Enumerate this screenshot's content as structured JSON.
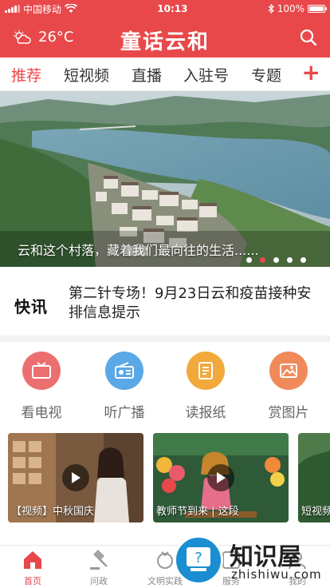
{
  "status_bar": {
    "carrier": "中国移动",
    "time": "10:13",
    "battery": "100%"
  },
  "header": {
    "temperature": "26°C",
    "app_title": "童话云和"
  },
  "tabs": [
    {
      "label": "推荐",
      "active": true
    },
    {
      "label": "短视频",
      "active": false
    },
    {
      "label": "直播",
      "active": false
    },
    {
      "label": "入驻号",
      "active": false
    },
    {
      "label": "专题",
      "active": false
    }
  ],
  "banner": {
    "caption": "云和这个村落，藏着我们最向往的生活......",
    "slide_count": 5,
    "active_slide": 2
  },
  "news_flash": {
    "logo_text": "快讯",
    "headline": "第二针专场！9月23日云和疫苗接种安排信息提示"
  },
  "services": [
    {
      "label": "看电视",
      "icon": "tv-icon",
      "color": "#ec6f6f"
    },
    {
      "label": "听广播",
      "icon": "radio-icon",
      "color": "#5aa8e6"
    },
    {
      "label": "读报纸",
      "icon": "newspaper-icon",
      "color": "#f2a93b"
    },
    {
      "label": "赏图片",
      "icon": "picture-icon",
      "color": "#f08a5b"
    }
  ],
  "videos": [
    {
      "title": "【视频】中秋国庆"
    },
    {
      "title": "教师节到来 | 这段"
    },
    {
      "title": "短视频"
    }
  ],
  "bottom_nav": [
    {
      "label": "首页",
      "icon": "home-icon",
      "active": true
    },
    {
      "label": "问政",
      "icon": "gavel-icon",
      "active": false
    },
    {
      "label": "文明实践",
      "icon": "practice-icon",
      "active": false
    },
    {
      "label": "服务",
      "icon": "service-icon",
      "active": false
    },
    {
      "label": "我的",
      "icon": "user-icon",
      "active": false
    }
  ],
  "watermark": {
    "text": "知识屋",
    "url": "zhishiwu.com"
  }
}
